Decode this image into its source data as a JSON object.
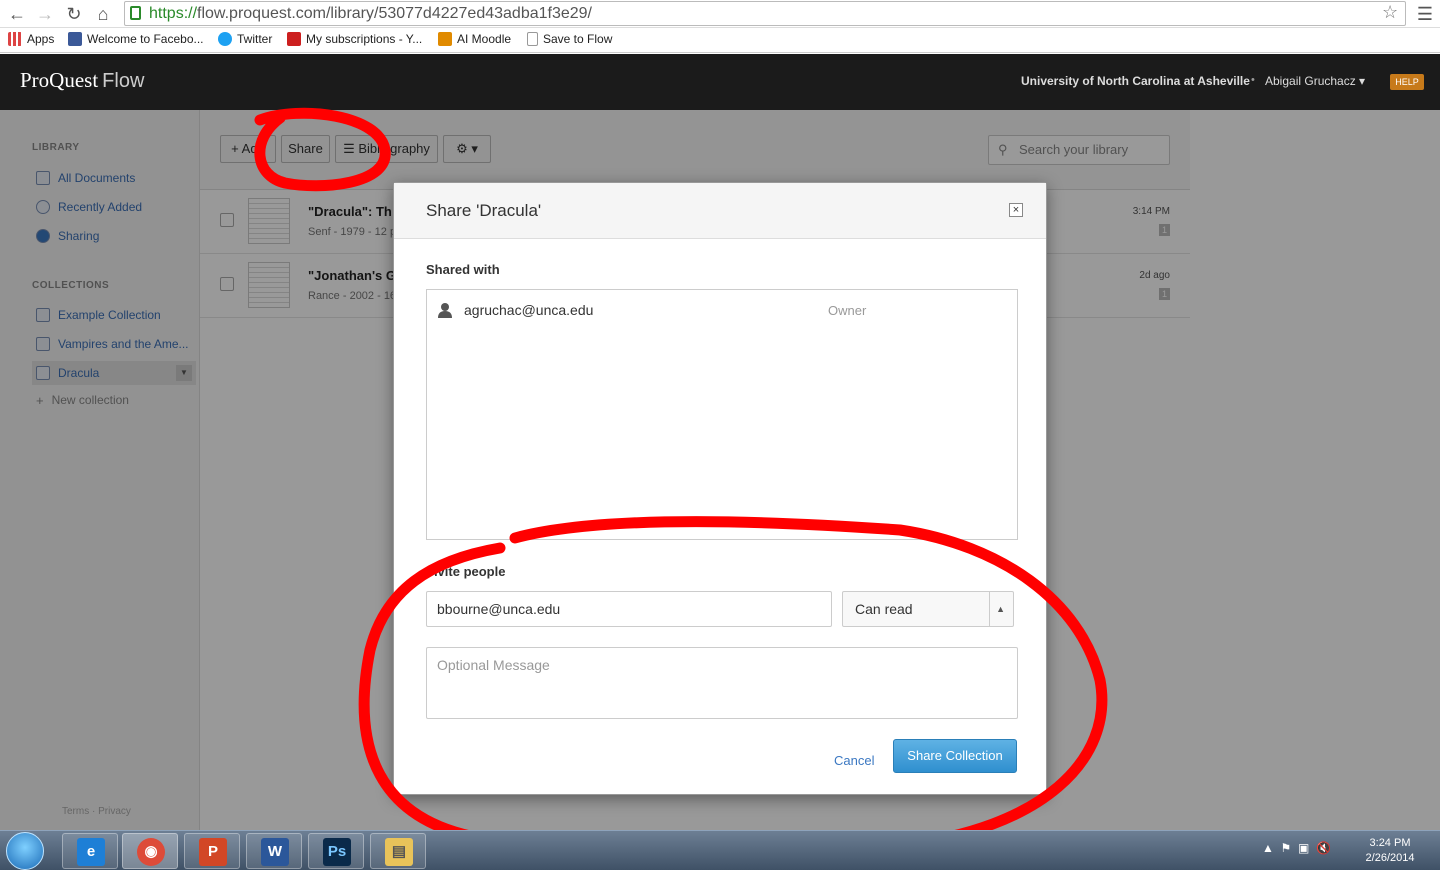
{
  "browser": {
    "url_protocol": "https://",
    "url_rest": "flow.proquest.com/library/53077d4227ed43adba1f3e29/",
    "bookmarks": [
      {
        "label": "Apps",
        "icon": "apps-grid-icon",
        "color": "#d44"
      },
      {
        "label": "Welcome to Facebo...",
        "icon": "facebook-icon",
        "color": "#3b5998"
      },
      {
        "label": "Twitter",
        "icon": "twitter-icon",
        "color": "#1da1f2"
      },
      {
        "label": "My subscriptions - Y...",
        "icon": "youtube-icon",
        "color": "#cc1f1f"
      },
      {
        "label": "AI Moodle",
        "icon": "moodle-icon",
        "color": "#e08a00"
      },
      {
        "label": "Save to Flow",
        "icon": "page-icon",
        "color": "#ddd"
      }
    ]
  },
  "header": {
    "brand": "ProQuest",
    "product": "Flow",
    "institution": "University of North Carolina at Asheville",
    "separator": "•",
    "user": "Abigail Gruchacz ▾",
    "help": "HELP"
  },
  "sidebar": {
    "library_heading": "LIBRARY",
    "library_items": [
      {
        "label": "All Documents",
        "icon": "document-icon"
      },
      {
        "label": "Recently Added",
        "icon": "clock-icon"
      },
      {
        "label": "Sharing",
        "icon": "sharing-icon"
      }
    ],
    "collections_heading": "COLLECTIONS",
    "collections": [
      {
        "label": "Example Collection"
      },
      {
        "label": "Vampires and the Ame..."
      },
      {
        "label": "Dracula"
      }
    ],
    "new_collection": "New collection",
    "footer": "Terms · Privacy"
  },
  "toolbar": {
    "add": "Add",
    "share": "Share",
    "bibliography": "Bibliography",
    "search_placeholder": "Search your library"
  },
  "documents": [
    {
      "title": "\"Dracula\": Th",
      "meta": "Senf - 1979 - 12 p",
      "time": "3:14 PM",
      "count": "1"
    },
    {
      "title": "\"Jonathan's G",
      "meta": "Rance - 2002 - 16",
      "time": "2d ago",
      "count": "1"
    }
  ],
  "modal": {
    "title": "Share 'Dracula'",
    "close": "×",
    "shared_with_label": "Shared with",
    "shared": [
      {
        "email": "agruchac@unca.edu",
        "role": "Owner"
      }
    ],
    "invite_label": "Invite people",
    "invite_email": "bbourne@unca.edu",
    "permission": "Can read",
    "message_placeholder": "Optional Message",
    "cancel": "Cancel",
    "submit": "Share Collection"
  },
  "taskbar": {
    "apps": [
      {
        "icon": "internet-explorer-icon",
        "glyph": "e",
        "color": "#1e7fd6"
      },
      {
        "icon": "chrome-icon",
        "glyph": "◉",
        "color": "#dd4b39"
      },
      {
        "icon": "powerpoint-icon",
        "glyph": "P",
        "color": "#d24726"
      },
      {
        "icon": "word-icon",
        "glyph": "W",
        "color": "#2b579a"
      },
      {
        "icon": "photoshop-icon",
        "glyph": "Ps",
        "color": "#0a2a4a"
      },
      {
        "icon": "file-explorer-icon",
        "glyph": "▤",
        "color": "#e8c35a"
      }
    ],
    "time": "3:24 PM",
    "date": "2/26/2014"
  },
  "annotation_color": "#ff0000"
}
